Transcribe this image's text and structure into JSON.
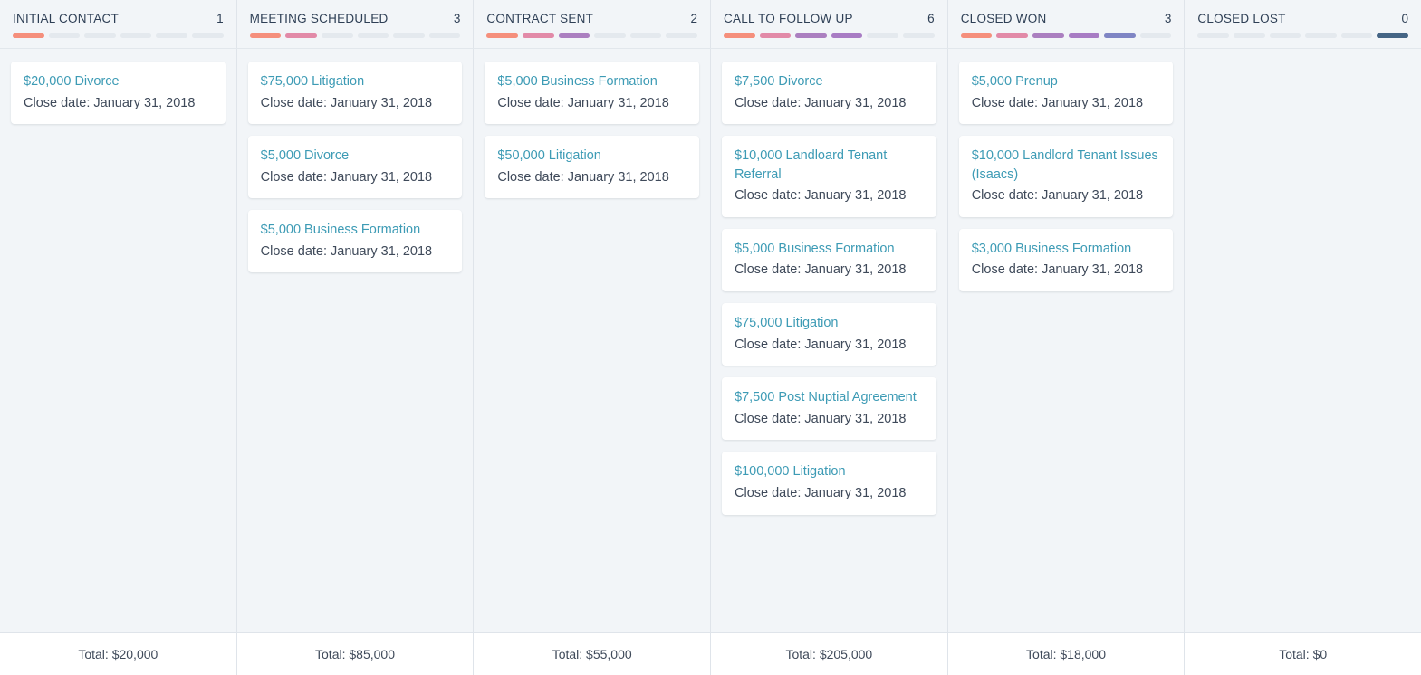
{
  "board": {
    "palette": {
      "accent_link": "#3d9bb5",
      "segment_empty": "#e4e9ee",
      "segment_1": "#f58f7c",
      "segment_2": "#e28aa8",
      "segment_3": "#ab7fc0",
      "segment_4": "#a87cc4",
      "segment_5": "#7f85c4",
      "segment_lost": "#456585",
      "column_bg": "#f2f5f8",
      "card_bg": "#ffffff"
    },
    "segment_count": 6,
    "total_label_prefix": "Total: ",
    "close_date_prefix": "Close date: ",
    "columns": [
      {
        "stage": "INITIAL CONTACT",
        "count": "1",
        "filled_segments": 1,
        "lost_style": false,
        "total": "Total: $20,000",
        "cards": [
          {
            "title": "$20,000 Divorce",
            "close_date": "Close date: January 31, 2018"
          }
        ]
      },
      {
        "stage": "MEETING SCHEDULED",
        "count": "3",
        "filled_segments": 2,
        "lost_style": false,
        "total": "Total: $85,000",
        "cards": [
          {
            "title": "$75,000 Litigation",
            "close_date": "Close date: January 31, 2018"
          },
          {
            "title": "$5,000 Divorce",
            "close_date": "Close date: January 31, 2018"
          },
          {
            "title": "$5,000 Business Formation",
            "close_date": "Close date: January 31, 2018"
          }
        ]
      },
      {
        "stage": "CONTRACT SENT",
        "count": "2",
        "filled_segments": 3,
        "lost_style": false,
        "total": "Total: $55,000",
        "cards": [
          {
            "title": "$5,000 Business Formation",
            "close_date": "Close date: January 31, 2018"
          },
          {
            "title": "$50,000 Litigation",
            "close_date": "Close date: January 31, 2018"
          }
        ]
      },
      {
        "stage": "CALL TO FOLLOW UP",
        "count": "6",
        "filled_segments": 4,
        "lost_style": false,
        "total": "Total: $205,000",
        "cards": [
          {
            "title": "$7,500 Divorce",
            "close_date": "Close date: January 31, 2018"
          },
          {
            "title": "$10,000 Landloard Tenant Referral",
            "close_date": "Close date: January 31, 2018"
          },
          {
            "title": "$5,000 Business Formation",
            "close_date": "Close date: January 31, 2018"
          },
          {
            "title": "$75,000 Litigation",
            "close_date": "Close date: January 31, 2018"
          },
          {
            "title": "$7,500 Post Nuptial Agreement",
            "close_date": "Close date: January 31, 2018"
          },
          {
            "title": "$100,000 Litigation",
            "close_date": "Close date: January 31, 2018"
          }
        ]
      },
      {
        "stage": "CLOSED WON",
        "count": "3",
        "filled_segments": 5,
        "lost_style": false,
        "total": "Total: $18,000",
        "cards": [
          {
            "title": "$5,000 Prenup",
            "close_date": "Close date: January 31, 2018"
          },
          {
            "title": "$10,000 Landlord Tenant Issues (Isaacs)",
            "close_date": "Close date: January 31, 2018"
          },
          {
            "title": "$3,000 Business Formation",
            "close_date": "Close date: January 31, 2018"
          }
        ]
      },
      {
        "stage": "CLOSED LOST",
        "count": "0",
        "filled_segments": 0,
        "lost_style": true,
        "total": "Total: $0",
        "cards": []
      }
    ]
  }
}
